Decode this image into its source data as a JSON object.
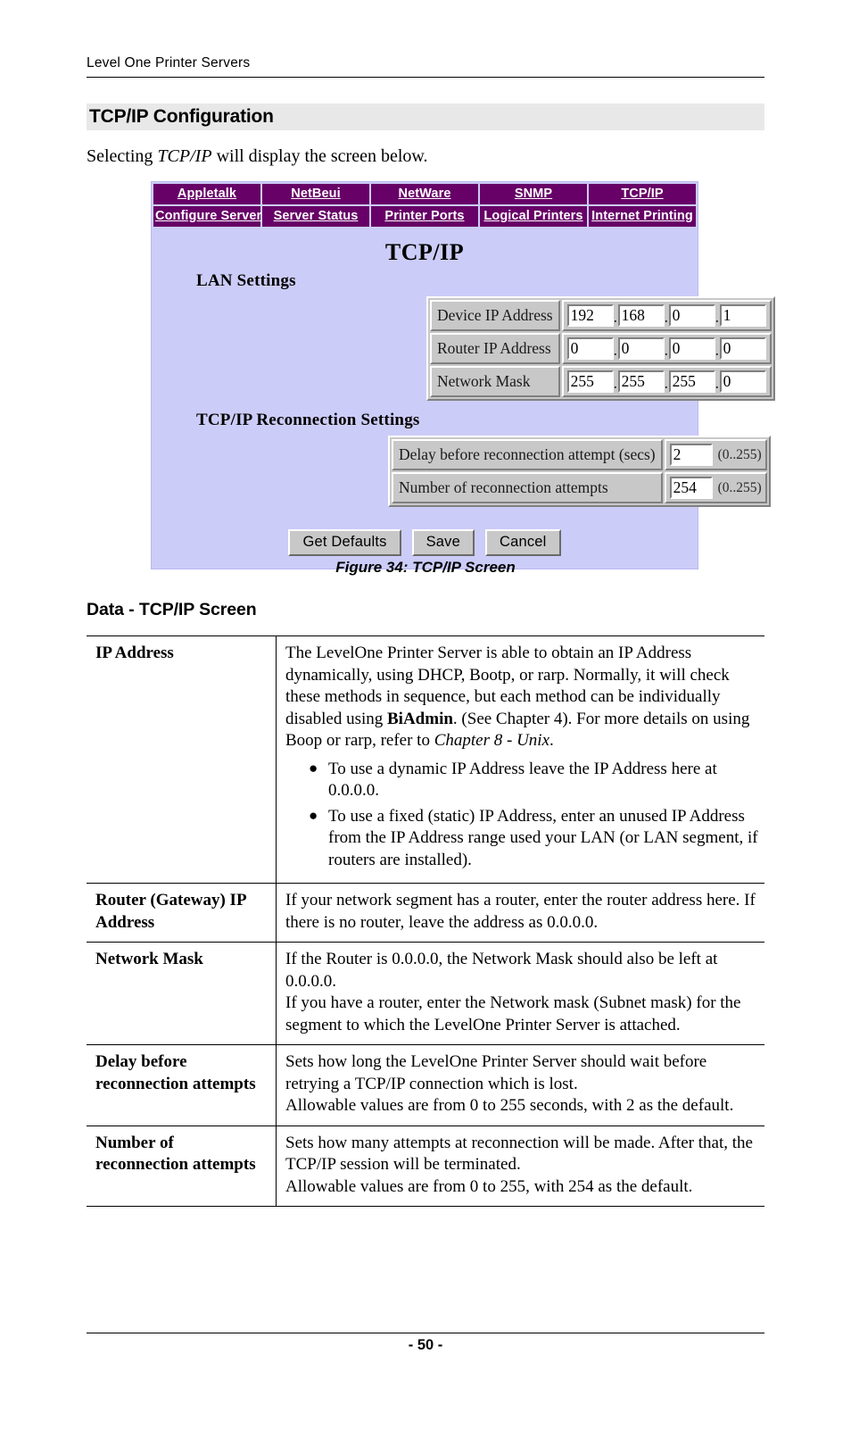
{
  "running_header": "Level One Printer Servers",
  "heading1": "TCP/IP Configuration",
  "intro": {
    "before": "Selecting ",
    "italic": "TCP/IP",
    "after": " will display the screen below."
  },
  "screenshot": {
    "nav_row1": [
      "Appletalk",
      "NetBeui",
      "NetWare",
      "SNMP",
      "TCP/IP"
    ],
    "nav_row2": [
      "Configure Server",
      "Server Status",
      "Printer Ports",
      "Logical Printers",
      "Internet Printing"
    ],
    "title": "TCP/IP",
    "lan_settings": {
      "heading": "LAN Settings",
      "rows": [
        {
          "label": "Device IP Address",
          "octets": [
            "192",
            "168",
            "0",
            "1"
          ]
        },
        {
          "label": "Router IP Address",
          "octets": [
            "0",
            "0",
            "0",
            "0"
          ]
        },
        {
          "label": "Network Mask",
          "octets": [
            "255",
            "255",
            "255",
            "0"
          ]
        }
      ]
    },
    "reconnection_settings": {
      "heading": "TCP/IP Reconnection Settings",
      "rows": [
        {
          "label": "Delay before reconnection attempt (secs)",
          "value": "2",
          "range": "(0..255)"
        },
        {
          "label": "Number of reconnection attempts",
          "value": "254",
          "range": "(0..255)"
        }
      ]
    },
    "buttons": [
      "Get Defaults",
      "Save",
      "Cancel"
    ],
    "colors": {
      "nav_purple": "#670067",
      "page_lavender": "#ccccf8",
      "control_grey": "#c8c8c8"
    }
  },
  "figure_caption": "Figure 34: TCP/IP Screen",
  "heading2": "Data - TCP/IP Screen",
  "data_table": {
    "rows": [
      {
        "term": "IP Address",
        "para_parts": {
          "p1a": "The LevelOne Printer Server is able to obtain an IP Address dynamically, using DHCP, Bootp, or rarp. Normally, it will check these methods in sequence, but each method can be individually disabled using ",
          "p1b": "BiAdmin",
          "p1c": ". (See Chapter 4). For more details on using Boop or rarp, refer to ",
          "p1d": "Chapter 8 - Unix",
          "p1e": "."
        },
        "bullets": [
          "To use a dynamic IP Address leave the IP Address here at 0.0.0.0.",
          "To use a fixed (static) IP Address, enter an unused IP Address from the IP Address range used your LAN (or LAN segment, if routers are installed)."
        ]
      },
      {
        "term": "Router (Gateway) IP Address",
        "text": "If your network segment has a router, enter the router address here. If there is no router, leave the address as 0.0.0.0."
      },
      {
        "term": "Network Mask",
        "line1": "If the Router is 0.0.0.0, the Network Mask should also be left at 0.0.0.0.",
        "line2": "If you have a router, enter the Network mask (Subnet mask) for the segment to which the LevelOne Printer Server is attached."
      },
      {
        "term": "Delay before reconnection attempts",
        "line1": "Sets how long the LevelOne Printer Server should wait before retrying a TCP/IP connection which is lost.",
        "line2": "Allowable values are from 0 to 255 seconds, with 2 as the default."
      },
      {
        "term": "Number of reconnection attempts",
        "line1": "Sets how many attempts at reconnection will be made. After that, the TCP/IP session will be terminated.",
        "line2": "Allowable values are from 0 to 255, with 254 as the default."
      }
    ]
  },
  "footer_page": "- 50 -"
}
